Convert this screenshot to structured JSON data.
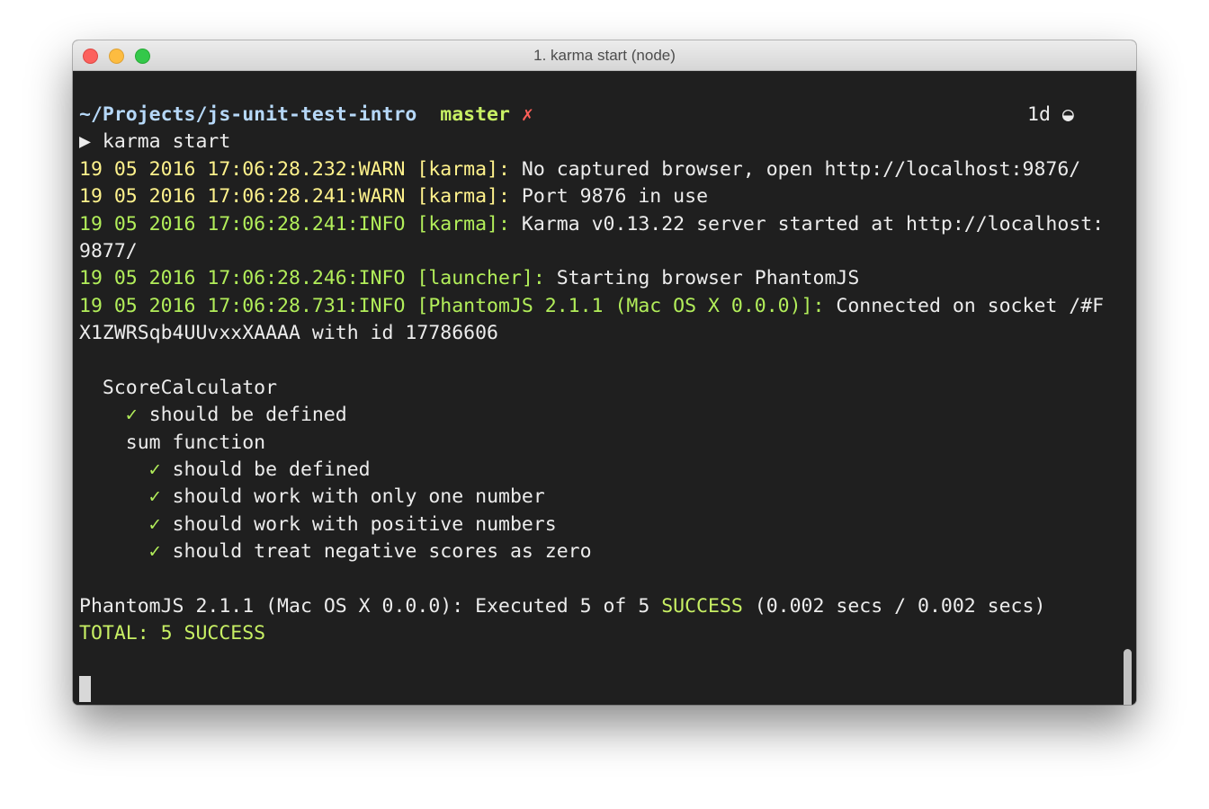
{
  "window": {
    "title": "1. karma start (node)"
  },
  "prompt": {
    "path": "~/Projects/js-unit-test-intro",
    "branch": "master",
    "dirty_mark": "✗",
    "right_prompt": "1d ◒",
    "arrow": "▶",
    "command": "karma start"
  },
  "log": [
    {
      "timestamp": "19 05 2016 17:06:28.232:WARN",
      "source": "[karma]:",
      "message": "No captured browser, open http://localhost:9876/"
    },
    {
      "timestamp": "19 05 2016 17:06:28.241:WARN",
      "source": "[karma]:",
      "message": "Port 9876 in use"
    },
    {
      "timestamp": "19 05 2016 17:06:28.241:INFO",
      "source": "[karma]:",
      "message": "Karma v0.13.22 server started at http://localhost:",
      "wrap": "9877/"
    },
    {
      "timestamp": "19 05 2016 17:06:28.246:INFO",
      "source": "[launcher]:",
      "message": "Starting browser PhantomJS"
    },
    {
      "timestamp": "19 05 2016 17:06:28.731:INFO",
      "source": "[PhantomJS 2.1.1 (Mac OS X 0.0.0)]:",
      "message": "Connected on socket /#F",
      "wrap": "X1ZWRSqb4UUvxxXAAAA with id 17786606"
    }
  ],
  "tests": {
    "check_mark": "✓",
    "suite": "ScoreCalculator",
    "suite_spec": "should be defined",
    "nested_suite": "sum function",
    "specs": [
      "should be defined",
      "should work with only one number",
      "should work with positive numbers",
      "should treat negative scores as zero"
    ]
  },
  "summary": {
    "executed_prefix": "PhantomJS 2.1.1 (Mac OS X 0.0.0): Executed 5 of 5",
    "success_word": "SUCCESS",
    "timing": "(0.002 secs / 0.002 secs)",
    "total": "TOTAL: 5 SUCCESS"
  },
  "colors": {
    "background": "#1f1f1f",
    "warn": "#fff28c",
    "info": "#b2ee5a",
    "path": "#b6d8f8",
    "error_mark": "#ff5f58"
  }
}
